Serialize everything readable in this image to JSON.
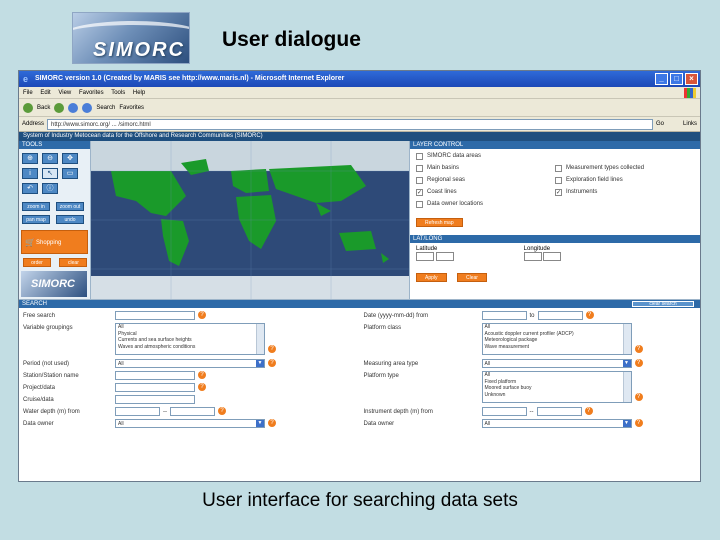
{
  "slide": {
    "title": "User dialogue",
    "caption": "User interface for searching data sets",
    "logo_text": "SIMORC"
  },
  "window": {
    "title": "SIMORC version 1.0 (Created by MARIS see http://www.maris.nl) - Microsoft Internet Explorer",
    "menu": [
      "File",
      "Edit",
      "View",
      "Favorites",
      "Tools",
      "Help"
    ],
    "toolbar": [
      "Back",
      "Search",
      "Favorites"
    ],
    "address_label": "Address",
    "address": "http://www.simorc.org/ ... /simorc.html",
    "go_label": "Go",
    "links_label": "Links"
  },
  "banner": "System of Industry Metocean data for the Offshore and Research Communities (SIMORC)",
  "tools": {
    "header": "TOOLS",
    "buttons": [
      "⊕",
      "⊖",
      "✥",
      "i",
      "↖",
      "▭",
      "↶",
      "ⓘ"
    ],
    "blue_buttons": [
      "zoom in",
      "zoom out",
      "pan map",
      "undo"
    ],
    "cart_label": "Shopping",
    "orange_buttons": [
      "order",
      "clear"
    ]
  },
  "layer_control": {
    "header": "LAYER CONTROL",
    "layers": [
      {
        "label": "SIMORC data areas",
        "checked": false
      },
      {
        "label": "Measurement types collected",
        "checked": false
      },
      {
        "label": "Main basins",
        "checked": false
      },
      {
        "label": "Regional seas",
        "checked": false
      },
      {
        "label": "Regional seas",
        "checked": false
      },
      {
        "label": "Exploration field lines",
        "checked": false
      },
      {
        "label": "Coast lines",
        "checked": true
      },
      {
        "label": "Instruments",
        "checked": true
      },
      {
        "label": "Data owner locations",
        "checked": false
      }
    ],
    "apply_label": "Refresh map"
  },
  "lat_long": {
    "header": "LAT/LONG",
    "lat_label": "Latitude",
    "lon_label": "Longitude",
    "buttons": [
      "Apply",
      "Clear"
    ]
  },
  "search": {
    "header": "SEARCH",
    "clear_label": "clear search",
    "left": {
      "free_search": "Free search",
      "variable_groupings": "Variable groupings",
      "variable_options": [
        "All",
        "Physical",
        "Currents and sea surface heights",
        "Waves and atmospheric conditions"
      ],
      "period": "Period (not used)",
      "period_value": "All",
      "station_name": "Station/Station name",
      "project": "Project/data",
      "cruise": "Cruise/data",
      "water_depth": "Water depth (m) from",
      "data_owner": "Data owner",
      "data_owner_value": "All"
    },
    "right": {
      "date_from": "Date (yyyy-mm-dd) from",
      "to": "to",
      "platform_class": "Platform class",
      "platform_options": [
        "All",
        "Acoustic doppler current profiler (ADCP)",
        "Meteorological package",
        "Wave measurement"
      ],
      "measuring_area": "Measuring area type",
      "measuring_area_value": "All",
      "platform_type": "Platform type",
      "platform_type_options": [
        "All",
        "Fixed platform",
        "Moored surface buoy",
        "Unknown"
      ],
      "instrument_depth": "Instrument depth (m) from",
      "data_owner": "Data owner",
      "data_owner_value": "All"
    }
  },
  "colors": {
    "accent": "#f07d1e",
    "header": "#2d6aa8",
    "titlebar": "#2f6ad8"
  }
}
